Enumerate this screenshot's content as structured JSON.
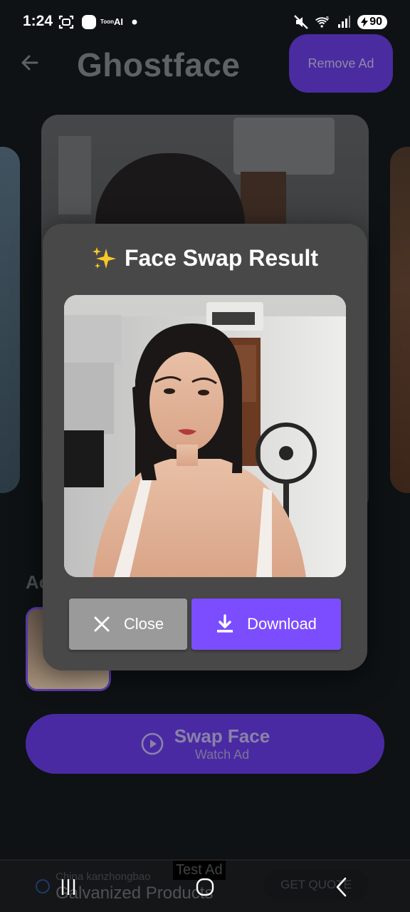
{
  "status_bar": {
    "time": "1:24",
    "toon_label_small": "Toon",
    "toon_label_big": "AI",
    "battery": "90",
    "wifi_badge": "5"
  },
  "app_bar": {
    "title": "Ghostface",
    "remove_ad_label": "Remove Ad"
  },
  "background": {
    "section_label_partial": "Ac",
    "swap_button_title": "Swap Face",
    "swap_button_subtitle": "Watch Ad"
  },
  "modal": {
    "title": "Face Swap Result",
    "close_label": "Close",
    "download_label": "Download"
  },
  "ad_banner": {
    "sponsor": "China kanzhongbao",
    "title": "Galvanized Products",
    "tag": "Test Ad",
    "cta": "GET QUOTE"
  },
  "colors": {
    "accent": "#7c4dff",
    "dimmed_accent": "#4a2aa3",
    "modal_bg": "#484848",
    "close_button": "#9a9a9a"
  }
}
